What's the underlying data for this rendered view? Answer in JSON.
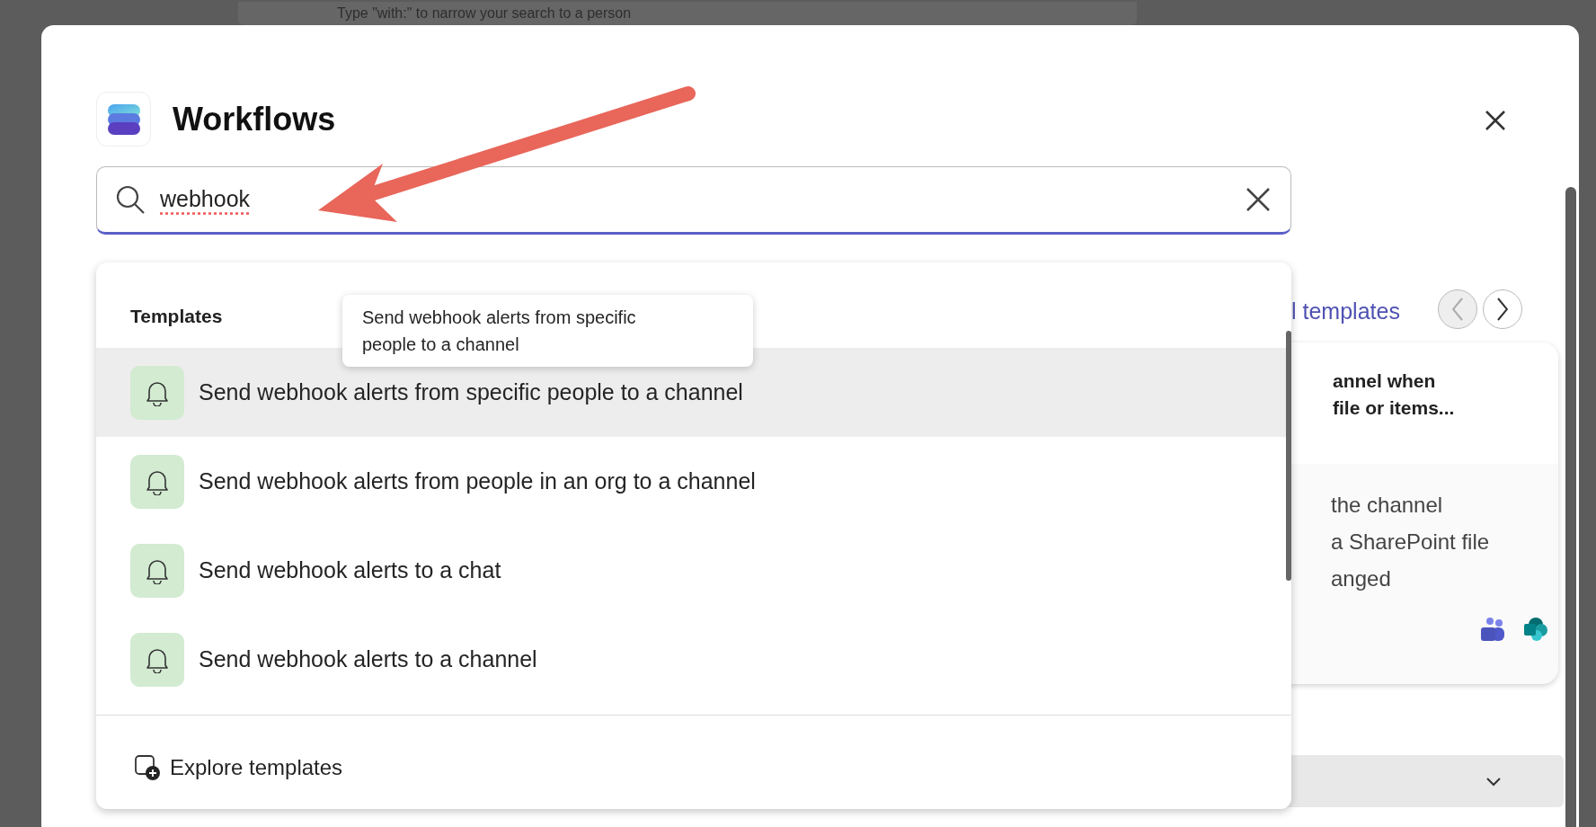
{
  "background_search": {
    "placeholder": "Type \"with:\" to narrow your search to a person"
  },
  "dialog": {
    "title": "Workflows"
  },
  "search": {
    "value": "webhook"
  },
  "behind": {
    "link": "l templates",
    "nav": [
      {
        "kind": "prev",
        "disabled": true
      },
      {
        "kind": "next",
        "disabled": false
      }
    ],
    "card": {
      "title_lines": [
        "annel when",
        "file or items..."
      ],
      "description_lines": [
        "the channel",
        "a SharePoint file",
        "anged"
      ]
    }
  },
  "dropdown": {
    "section": "Templates",
    "tooltip": "Send webhook alerts from specific people to a channel",
    "items": [
      {
        "label": "Send webhook alerts from specific people to a channel",
        "selected": true
      },
      {
        "label": "Send webhook alerts from people in an org to a channel",
        "selected": false
      },
      {
        "label": "Send webhook alerts to a chat",
        "selected": false
      },
      {
        "label": "Send webhook alerts to a channel",
        "selected": false
      }
    ],
    "footer": "Explore templates"
  }
}
